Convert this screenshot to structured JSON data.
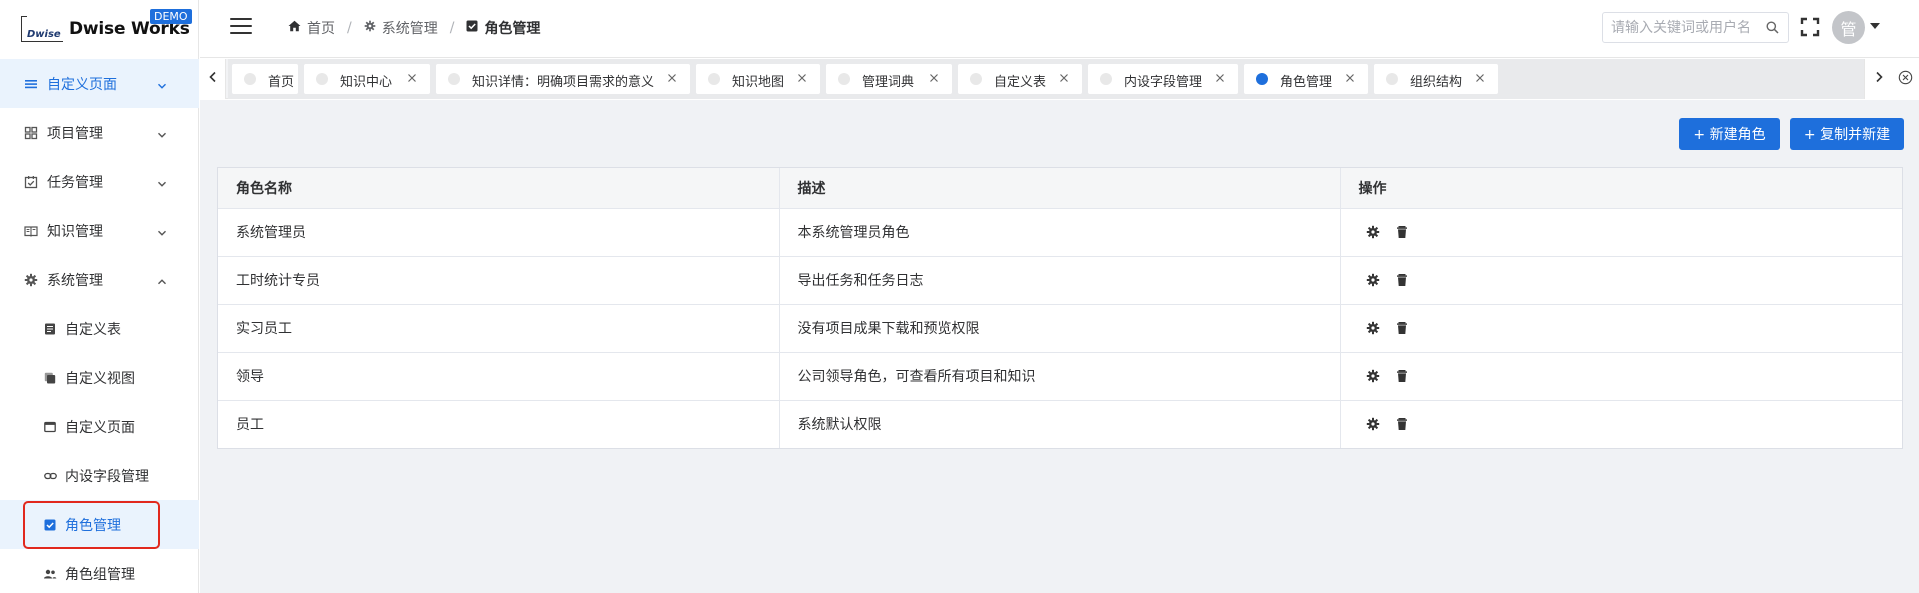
{
  "sidebar": {
    "logo_mark": "Dwise",
    "logo_text": "Dwise Works",
    "badge": "DEMO",
    "menu": [
      {
        "label": "自定义页面",
        "icon": "list-icon",
        "expanded": false,
        "active": true
      },
      {
        "label": "项目管理",
        "icon": "grid-icon",
        "expanded": false
      },
      {
        "label": "任务管理",
        "icon": "task-check-icon",
        "expanded": false
      },
      {
        "label": "知识管理",
        "icon": "book-icon",
        "expanded": false
      },
      {
        "label": "系统管理",
        "icon": "gear-icon",
        "expanded": true
      }
    ],
    "submenu": [
      {
        "label": "自定义表",
        "icon": "document-icon"
      },
      {
        "label": "自定义视图",
        "icon": "copy-icon"
      },
      {
        "label": "自定义页面",
        "icon": "window-icon"
      },
      {
        "label": "内设字段管理",
        "icon": "link-icon"
      },
      {
        "label": "角色管理",
        "icon": "checkbox-icon",
        "selected": true
      },
      {
        "label": "角色组管理",
        "icon": "people-icon"
      }
    ]
  },
  "header": {
    "breadcrumb": [
      {
        "label": "首页",
        "icon": "home-icon"
      },
      {
        "label": "系统管理",
        "icon": "gear-icon"
      },
      {
        "label": "角色管理",
        "icon": "checkbox-icon"
      }
    ],
    "search_placeholder": "请输入关键词或用户名",
    "avatar_text": "管"
  },
  "tabs": [
    {
      "label": "首页",
      "closable": false
    },
    {
      "label": "知识中心",
      "closable": true
    },
    {
      "label": "知识详情：明确项目需求的意义",
      "closable": true
    },
    {
      "label": "知识地图",
      "closable": true
    },
    {
      "label": "管理词典",
      "closable": true
    },
    {
      "label": "自定义表",
      "closable": true
    },
    {
      "label": "内设字段管理",
      "closable": true
    },
    {
      "label": "角色管理",
      "closable": true,
      "active": true
    },
    {
      "label": "组织结构",
      "closable": true
    }
  ],
  "actions": {
    "new_role": "+ 新建角色",
    "copy_new": "+ 复制并新建"
  },
  "table": {
    "columns": [
      "角色名称",
      "描述",
      "操作"
    ],
    "rows": [
      {
        "name": "系统管理员",
        "desc": "本系统管理员角色"
      },
      {
        "name": "工时统计专员",
        "desc": "导出任务和任务日志"
      },
      {
        "name": "实习员工",
        "desc": "没有项目成果下载和预览权限"
      },
      {
        "name": "领导",
        "desc": "公司领导角色，可查看所有项目和知识"
      },
      {
        "name": "员工",
        "desc": "系统默认权限"
      }
    ]
  },
  "colors": {
    "accent": "#1e6fdc",
    "highlight": "#e1281d",
    "background": "#f0f2f5"
  }
}
